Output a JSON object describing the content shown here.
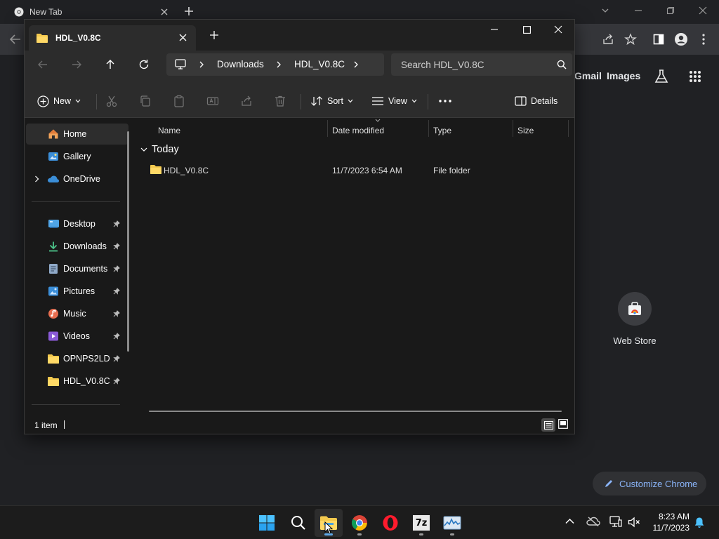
{
  "chrome": {
    "tab_title": "New Tab",
    "links": {
      "gmail": "Gmail",
      "images": "Images"
    },
    "shortcut": {
      "label": "Web Store",
      "icon": "webstore-icon"
    },
    "customize_label": "Customize Chrome"
  },
  "explorer": {
    "tab_title": "HDL_V0.8C",
    "address": {
      "segments": [
        "Downloads",
        "HDL_V0.8C"
      ]
    },
    "search_placeholder": "Search HDL_V0.8C",
    "commands": {
      "new": "New",
      "sort": "Sort",
      "view": "View",
      "details": "Details"
    },
    "sidebar": {
      "top": [
        {
          "label": "Home",
          "icon": "home-icon"
        },
        {
          "label": "Gallery",
          "icon": "gallery-icon"
        },
        {
          "label": "OneDrive",
          "icon": "onedrive-icon"
        }
      ],
      "pinned": [
        {
          "label": "Desktop",
          "icon": "desktop-icon"
        },
        {
          "label": "Downloads",
          "icon": "download-icon"
        },
        {
          "label": "Documents",
          "icon": "documents-icon"
        },
        {
          "label": "Pictures",
          "icon": "pictures-icon"
        },
        {
          "label": "Music",
          "icon": "music-icon"
        },
        {
          "label": "Videos",
          "icon": "videos-icon"
        },
        {
          "label": "OPNPS2LD",
          "icon": "folder-icon"
        },
        {
          "label": "HDL_V0.8C",
          "icon": "folder-icon"
        }
      ]
    },
    "columns": {
      "name": "Name",
      "date": "Date modified",
      "type": "Type",
      "size": "Size"
    },
    "group_label": "Today",
    "rows": [
      {
        "name": "HDL_V0.8C",
        "date": "11/7/2023 6:54 AM",
        "type": "File folder",
        "size": ""
      }
    ],
    "status": "1 item"
  },
  "taskbar": {
    "apps": [
      "start-icon",
      "search-icon",
      "file-explorer-icon",
      "chrome-icon",
      "opera-icon",
      "7zip-icon",
      "task-manager-icon"
    ],
    "seven_zip_text": "7z",
    "time": "8:23 AM",
    "date": "11/7/2023"
  },
  "colors": {
    "accent": "#5ea8e8",
    "folder": "#f3c94e",
    "chrome_link": "#8ab4f8"
  }
}
